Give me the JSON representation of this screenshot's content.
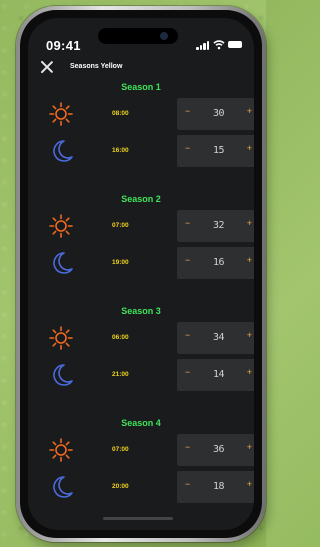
{
  "status": {
    "time": "09:41"
  },
  "nav": {
    "title": "Seasons Yellow"
  },
  "seasons": [
    {
      "title": "Season 1",
      "day": {
        "time": "08:00",
        "value": "30"
      },
      "night": {
        "time": "16:00",
        "value": "15"
      }
    },
    {
      "title": "Season 2",
      "day": {
        "time": "07:00",
        "value": "32"
      },
      "night": {
        "time": "19:00",
        "value": "16"
      }
    },
    {
      "title": "Season 3",
      "day": {
        "time": "06:00",
        "value": "34"
      },
      "night": {
        "time": "21:00",
        "value": "14"
      }
    },
    {
      "title": "Season 4",
      "day": {
        "time": "07:00",
        "value": "36"
      },
      "night": {
        "time": "20:00",
        "value": "18"
      }
    }
  ],
  "controls": {
    "minus": "−",
    "plus": "+"
  },
  "icons": {
    "day": "sun-icon",
    "night": "moon-icon",
    "close": "close-icon"
  },
  "colors": {
    "season_title": "#3ee35a",
    "time": "#f1d51c",
    "stepper_buttons": "#f0a34b",
    "sun": "#f06a1e",
    "moon": "#4b6be0",
    "screen_bg": "#1a1b1d"
  }
}
